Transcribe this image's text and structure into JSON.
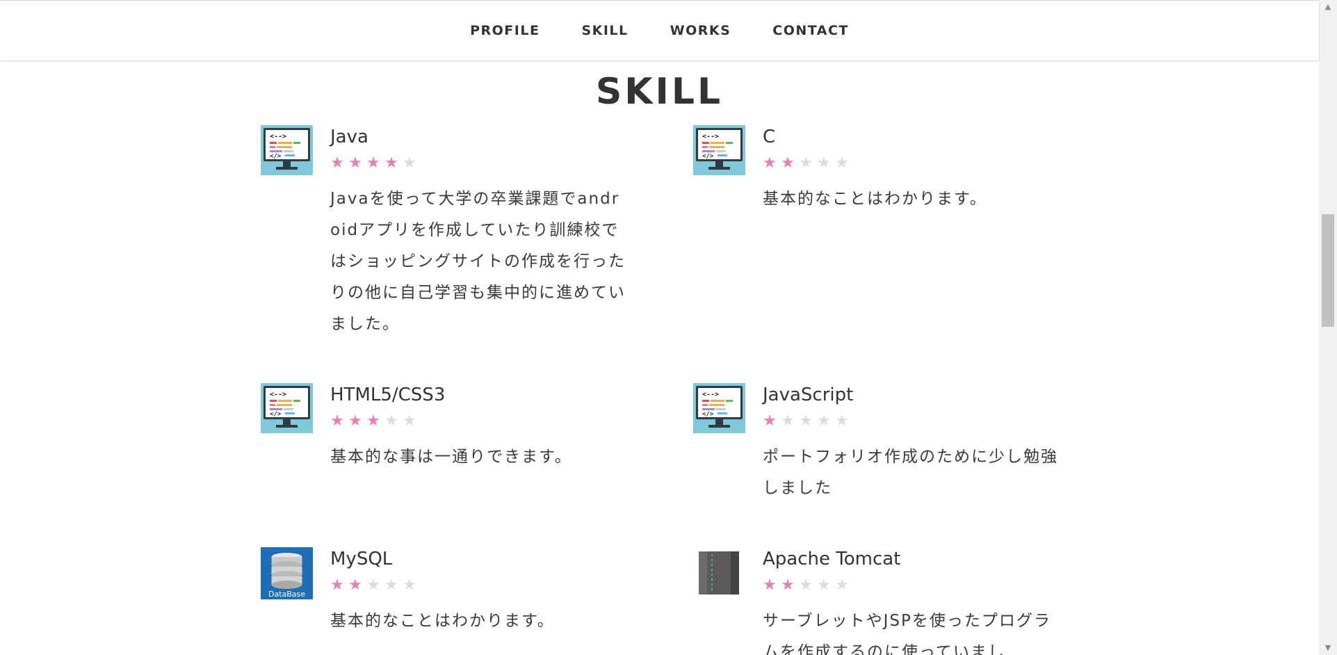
{
  "nav": {
    "items": [
      {
        "label": "PROFILE"
      },
      {
        "label": "SKILL"
      },
      {
        "label": "WORKS"
      },
      {
        "label": "CONTACT"
      }
    ]
  },
  "section": {
    "title": "SKILL"
  },
  "skills": [
    {
      "name": "Java",
      "icon": "monitor-code-icon",
      "rating": 4,
      "max_rating": 5,
      "description": "Javaを使って大学の卒業課題でandroidアプリを作成していたり訓練校ではショッピングサイトの作成を行ったりの他に自己学習も集中的に進めていました。"
    },
    {
      "name": "C",
      "icon": "monitor-code-icon",
      "rating": 2,
      "max_rating": 5,
      "description": "基本的なことはわかります。"
    },
    {
      "name": "HTML5/CSS3",
      "icon": "monitor-code-icon",
      "rating": 3,
      "max_rating": 5,
      "description": "基本的な事は一通りできます。"
    },
    {
      "name": "JavaScript",
      "icon": "monitor-code-icon",
      "rating": 1,
      "max_rating": 5,
      "description": "ポートフォリオ作成のために少し勉強しました"
    },
    {
      "name": "MySQL",
      "icon": "database-icon",
      "icon_text": "DataBase",
      "rating": 2,
      "max_rating": 5,
      "description": "基本的なことはわかります。"
    },
    {
      "name": "Apache Tomcat",
      "icon": "server-icon",
      "rating": 2,
      "max_rating": 5,
      "description": "サーブレットやJSPを使ったプログラムを作成するのに使っていまし"
    }
  ],
  "colors": {
    "star_on": "#e57fb6",
    "star_off": "#dcdcdc",
    "text": "#333333"
  }
}
